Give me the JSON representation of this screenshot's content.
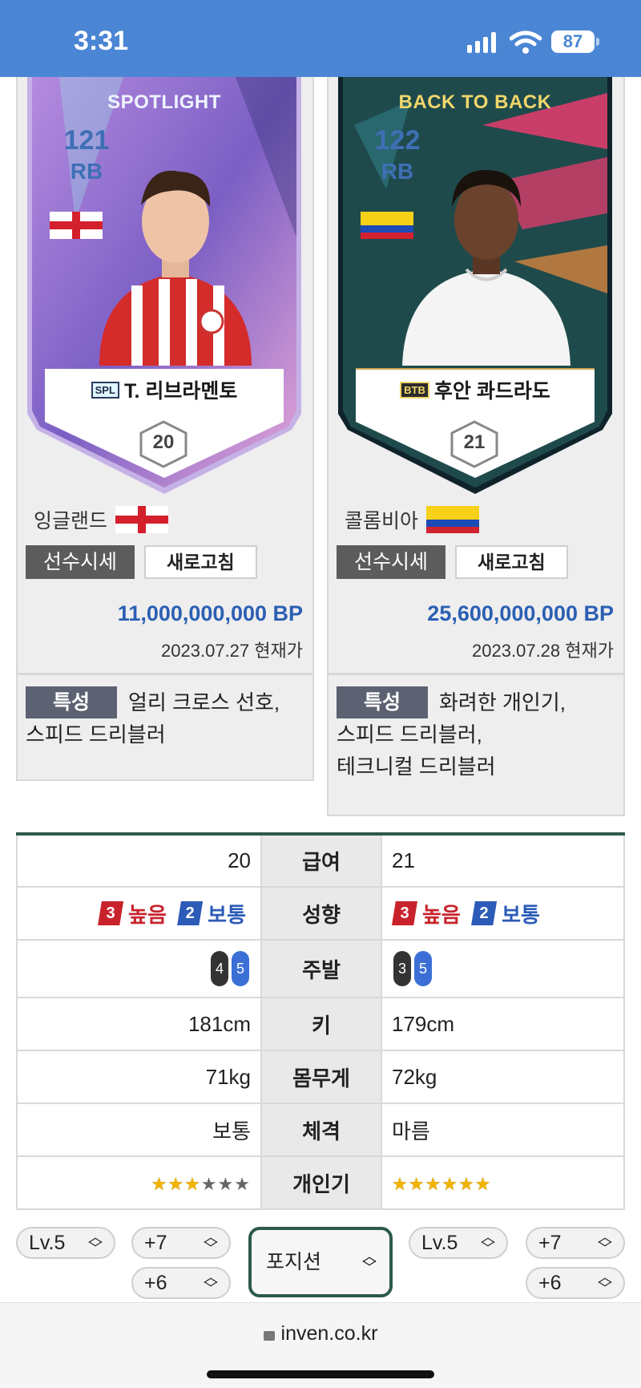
{
  "status_bar": {
    "time": "3:31",
    "battery": "87"
  },
  "players": [
    {
      "program": "SPOTLIGHT",
      "ovr": "121",
      "position": "RB",
      "badge": "SPL",
      "name": "T. 리브라멘토",
      "salary": "20",
      "nation": "잉글랜드",
      "price_label": "선수시세",
      "refresh_label": "새로고침",
      "price": "11,000,000,000 BP",
      "price_date": "2023.07.27 현재가",
      "trait_tag": "특성",
      "traits_line1": "얼리 크로스 선호,",
      "traits_line2": "스피드 드리블러",
      "traits_line3": ""
    },
    {
      "program": "BACK TO BACK",
      "ovr": "122",
      "position": "RB",
      "badge": "BTB",
      "name": "후안 콰드라도",
      "salary": "21",
      "nation": "콜롬비아",
      "price_label": "선수시세",
      "refresh_label": "새로고침",
      "price": "25,600,000,000 BP",
      "price_date": "2023.07.28 현재가",
      "trait_tag": "특성",
      "traits_line1": "화려한 개인기,",
      "traits_line2": "스피드 드리블러,",
      "traits_line3": "테크니컬 드리블러"
    }
  ],
  "compare": {
    "salary": {
      "label": "급여",
      "left": "20",
      "right": "21"
    },
    "work_rate": {
      "label": "성향",
      "left": {
        "att_num": "3",
        "att": "높음",
        "def_num": "2",
        "def": "보통"
      },
      "right": {
        "att_num": "3",
        "att": "높음",
        "def_num": "2",
        "def": "보통"
      }
    },
    "foot": {
      "label": "주발",
      "left": {
        "l": "4",
        "r": "5"
      },
      "right": {
        "l": "3",
        "r": "5"
      }
    },
    "height": {
      "label": "키",
      "left": "181cm",
      "right": "179cm"
    },
    "weight": {
      "label": "몸무게",
      "left": "71kg",
      "right": "72kg"
    },
    "body": {
      "label": "체격",
      "left": "보통",
      "right": "마름"
    },
    "skill": {
      "label": "개인기",
      "left_stars": 3,
      "right_stars": 6,
      "max": 6
    }
  },
  "selectors": {
    "left_level": "Lv.5",
    "left_plus_a": "+7",
    "left_plus_b": "+6",
    "position": "포지션",
    "right_level": "Lv.5",
    "right_plus_a": "+7",
    "right_plus_b": "+6"
  },
  "browser": {
    "url": "inven.co.kr"
  },
  "colors": {
    "status_bar": "#4a86d4",
    "price_text": "#2b5fb3",
    "high": "#c8232c",
    "medium": "#2c5bb8",
    "accent": "#2d5a4a"
  }
}
